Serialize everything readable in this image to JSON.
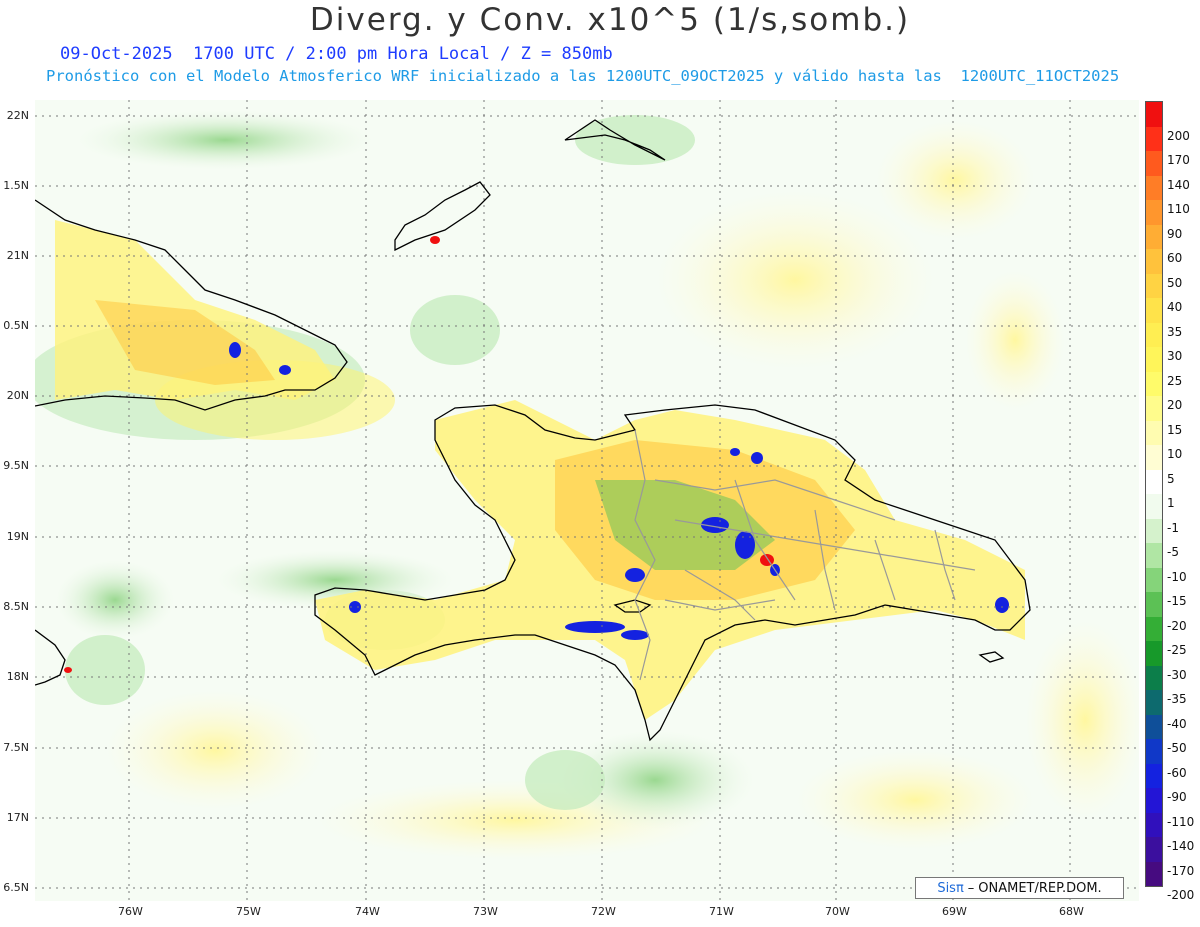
{
  "header": {
    "title": "Diverg. y Conv. x10^5 (1/s,somb.)",
    "subtitle_time": "09-Oct-2025  1700 UTC / 2:00 pm Hora Local / Z = 850mb",
    "subtitle_model": "Pronóstico con el Modelo Atmosferico WRF inicializado a las 1200UTC_09OCT2025 y válido hasta las  1200UTC_11OCT2025"
  },
  "map": {
    "lat_labels": [
      "22N",
      "1.5N",
      "21N",
      "0.5N",
      "20N",
      "9.5N",
      "19N",
      "8.5N",
      "18N",
      "7.5N",
      "17N",
      "6.5N"
    ],
    "lon_labels": [
      "76W",
      "75W",
      "74W",
      "73W",
      "72W",
      "71W",
      "70W",
      "69W",
      "68W"
    ]
  },
  "colorbar": {
    "labels": [
      "200",
      "170",
      "140",
      "110",
      "90",
      "60",
      "50",
      "40",
      "35",
      "30",
      "25",
      "20",
      "15",
      "10",
      "5",
      "1",
      "-1",
      "-5",
      "-10",
      "-15",
      "-20",
      "-25",
      "-30",
      "-35",
      "-40",
      "-50",
      "-60",
      "-90",
      "-110",
      "-140",
      "-170",
      "-200"
    ],
    "colors": [
      "#f01010",
      "#ff3018",
      "#ff5a1e",
      "#ff7d26",
      "#ff962d",
      "#ffad34",
      "#ffc23c",
      "#ffd343",
      "#ffe34a",
      "#ffee52",
      "#fff55a",
      "#fffb6a",
      "#fffc8c",
      "#fffcb0",
      "#fffdd3",
      "#ffffff",
      "#f1fbee",
      "#d5f2cc",
      "#b0e6a4",
      "#85d47a",
      "#5cc155",
      "#34ae36",
      "#17992a",
      "#0c7e4a",
      "#0d6a6e",
      "#0f4f99",
      "#1038c8",
      "#1422e0",
      "#2315d6",
      "#3010bc",
      "#3b0f9e",
      "#460b80"
    ]
  },
  "credit": {
    "sis": "Sisπ",
    "dash": "–",
    "org": "ONAMET/REP.DOM."
  }
}
